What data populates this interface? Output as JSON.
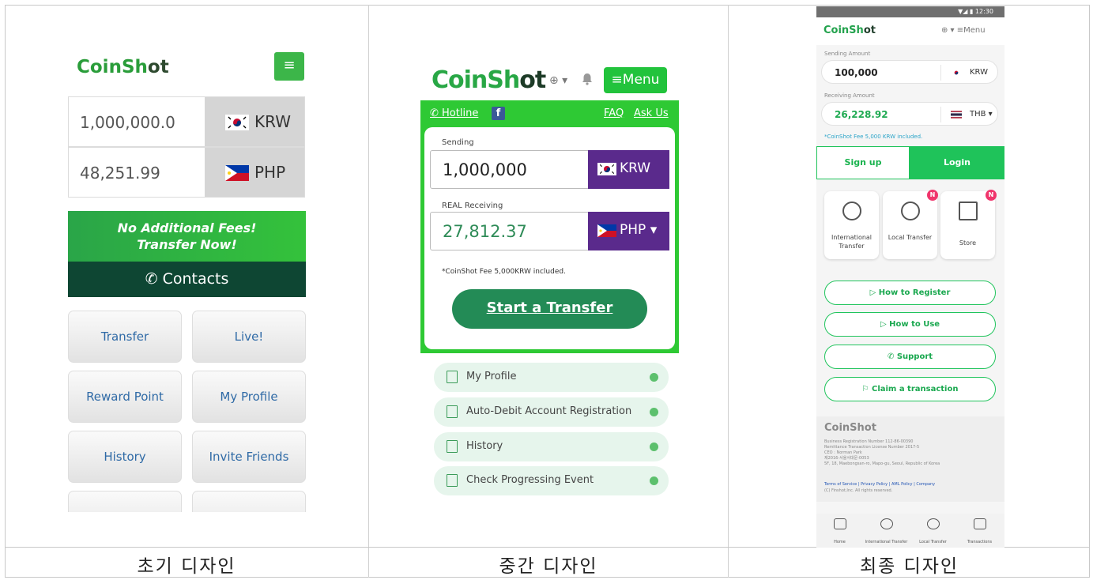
{
  "captions": [
    "초기 디자인",
    "중간 디자인",
    "최종 디자인"
  ],
  "p1": {
    "logo_a": "CoinSh",
    "logo_b": "ot",
    "menu_icon": "≡",
    "rows": [
      {
        "amount": "1,000,000.0",
        "currency": "KRW"
      },
      {
        "amount": "48,251.99",
        "currency": "PHP"
      }
    ],
    "banner_line1": "No Additional Fees!",
    "banner_line2": "Transfer Now!",
    "contacts": "✆ Contacts",
    "buttons": [
      "Transfer",
      "Live!",
      "Reward Point",
      "My Profile",
      "History",
      "Invite Friends"
    ]
  },
  "p2": {
    "logo_a": "CoinSh",
    "logo_b": "ot",
    "globe": "⊕ ▾",
    "menu": "≡Menu",
    "hotline": "✆ Hotline",
    "fb": "f",
    "faq": "FAQ",
    "ask": "Ask Us",
    "sending_label": "Sending",
    "sending_value": "1,000,000",
    "sending_currency": "KRW",
    "receiving_label": "REAL Receiving",
    "receiving_value": "27,812.37",
    "receiving_currency": "PHP ▾",
    "fee": "*CoinShot Fee 5,000KRW included.",
    "start": "Start a Transfer",
    "items": [
      "My Profile",
      "Auto-Debit Account Registration",
      "History",
      "Check Progressing Event"
    ]
  },
  "p3": {
    "status": "▼◢ ▮ 12:30",
    "logo_a": "CoinSh",
    "logo_b": "ot",
    "menu": "⊕ ▾  ≡Menu",
    "sending_label": "Sending Amount",
    "sending_value": "100,000",
    "sending_currency": "KRW",
    "receiving_label": "Receiving Amount",
    "receiving_value": "26,228.92",
    "receiving_currency": "THB ▾",
    "fee": "*CoinShot Fee 5,000 KRW included.",
    "signup": "Sign up",
    "login": "Login",
    "tiles": [
      {
        "label": "International Transfer",
        "badge": ""
      },
      {
        "label": "Local Transfer",
        "badge": "N"
      },
      {
        "label": "Store",
        "badge": "N"
      }
    ],
    "links": [
      "How to Register",
      "How to Use",
      "Support",
      "Claim a transaction"
    ],
    "footer_logo": "CoinShot",
    "footer_lines": [
      "Business Registration Number 112-86-00390",
      "Remittance Transaction License Number 2017-5",
      "CEO : Norman Park",
      "제2016-서울서대문-0053",
      "5F, 18, Maebongsan-ro, Mapo-gu, Seoul, Republic of Korea"
    ],
    "footer_links": "Terms of Service  |  Privacy Policy  |  AML Policy  |  Company",
    "copyright": "(C) Finshot,Inc. All rights reserved.",
    "nav": [
      "Home",
      "International Transfer",
      "Local Transfer",
      "Transactions"
    ]
  },
  "colors": {
    "p1_green": "#3cb649",
    "p2_green": "#2ec934",
    "p3_green": "#1fc35a",
    "purple": "#5a2a8c",
    "dark_green": "#0e4633"
  }
}
